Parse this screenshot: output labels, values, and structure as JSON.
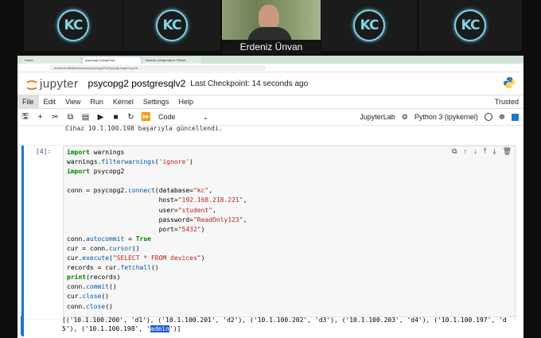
{
  "meeting": {
    "speaker_name": "Erdeniz Ünvan",
    "logo_text": "KC"
  },
  "browser": {
    "tabs": [
      "Home",
      "psycopg2 postgresql...",
      "Backup postgresql to Github..."
    ],
    "url": "localhost:8888/notebooks/psycopg2%20postgresqlv2.ipynb"
  },
  "jupyter": {
    "wordmark": "jupyter",
    "notebook_title": "psycopg2 postgresqlv2",
    "checkpoint": "Last Checkpoint: 14 seconds ago",
    "menu": [
      "File",
      "Edit",
      "View",
      "Run",
      "Kernel",
      "Settings",
      "Help"
    ],
    "trusted": "Trusted",
    "cell_type": "Code",
    "jupyterlab_label": "JupyterLab",
    "kernel": "Python 3 (ipykernel)",
    "prev_output": "Cihaz 10.1.100.198 başarıyla güncellendi.",
    "cell_prompt": "[4]:",
    "code_lines": [
      "import warnings",
      "warnings.filterwarnings('ignore')",
      "import psycopg2",
      "",
      "conn = psycopg2.connect(database=\"kc\",",
      "                        host=\"192.168.218.221\",",
      "                        user=\"student\",",
      "                        password=\"ReadOnly123\",",
      "                        port=\"5432\")",
      "conn.autocommit = True",
      "cur = conn.cursor()",
      "cur.execute(\"SELECT * FROM devices\")",
      "records = cur.fetchall()",
      "print(records)",
      "conn.commit()",
      "cur.close()",
      "conn.close()"
    ],
    "output_line1": "[('10.1.100.200', 'd1'), ('10.1.100.201', 'd2'), ('10.1.100.202', 'd3'), ('10.1.100.203', 'd4'), ('10.1.100.197', 'd",
    "output_line2_pre": "5'), ('10.1.100.198', '",
    "output_line2_hl": "admin",
    "output_line2_post": "')]"
  }
}
